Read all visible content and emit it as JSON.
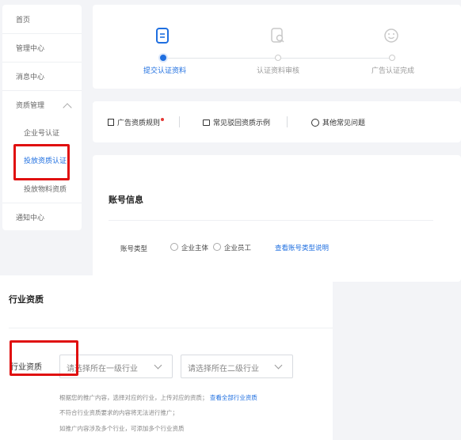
{
  "sidebar": {
    "items": [
      {
        "label": "首页"
      },
      {
        "label": "管理中心"
      },
      {
        "label": "消息中心"
      },
      {
        "label": "资质管理"
      },
      {
        "label": "企业号认证"
      },
      {
        "label": "投放资质认证"
      },
      {
        "label": "投放物料资质"
      },
      {
        "label": "通知中心"
      }
    ]
  },
  "steps": [
    {
      "label": "提交认证资料",
      "icon": "document-icon"
    },
    {
      "label": "认证资料审核",
      "icon": "review-icon"
    },
    {
      "label": "广告认证完成",
      "icon": "smile-icon"
    }
  ],
  "links": [
    {
      "label": "广告资质规则",
      "icon": "rules-icon"
    },
    {
      "label": "常见驳回资质示例",
      "icon": "chat-icon"
    },
    {
      "label": "其他常见问题",
      "icon": "info-icon"
    }
  ],
  "account": {
    "title": "账号信息",
    "type_label": "账号类型",
    "options": [
      "企业主体",
      "企业员工"
    ],
    "help_link": "查看账号类型说明"
  },
  "industry": {
    "title": "行业资质",
    "field_label": "行业资质",
    "select1_placeholder": "请选择所在一级行业",
    "select2_placeholder": "请选择所在二级行业",
    "hint_line1": "根据您的推广内容，选择对应的行业，上传对应的资质；",
    "hint_link": "查看全部行业资质",
    "hint_line2": "不符合行业资质要求的内容将无法进行推广；",
    "hint_line3": "如推广内容涉及多个行业，可添加多个行业资质"
  },
  "colors": {
    "accent": "#1f6fe0",
    "highlight": "#e01010"
  }
}
